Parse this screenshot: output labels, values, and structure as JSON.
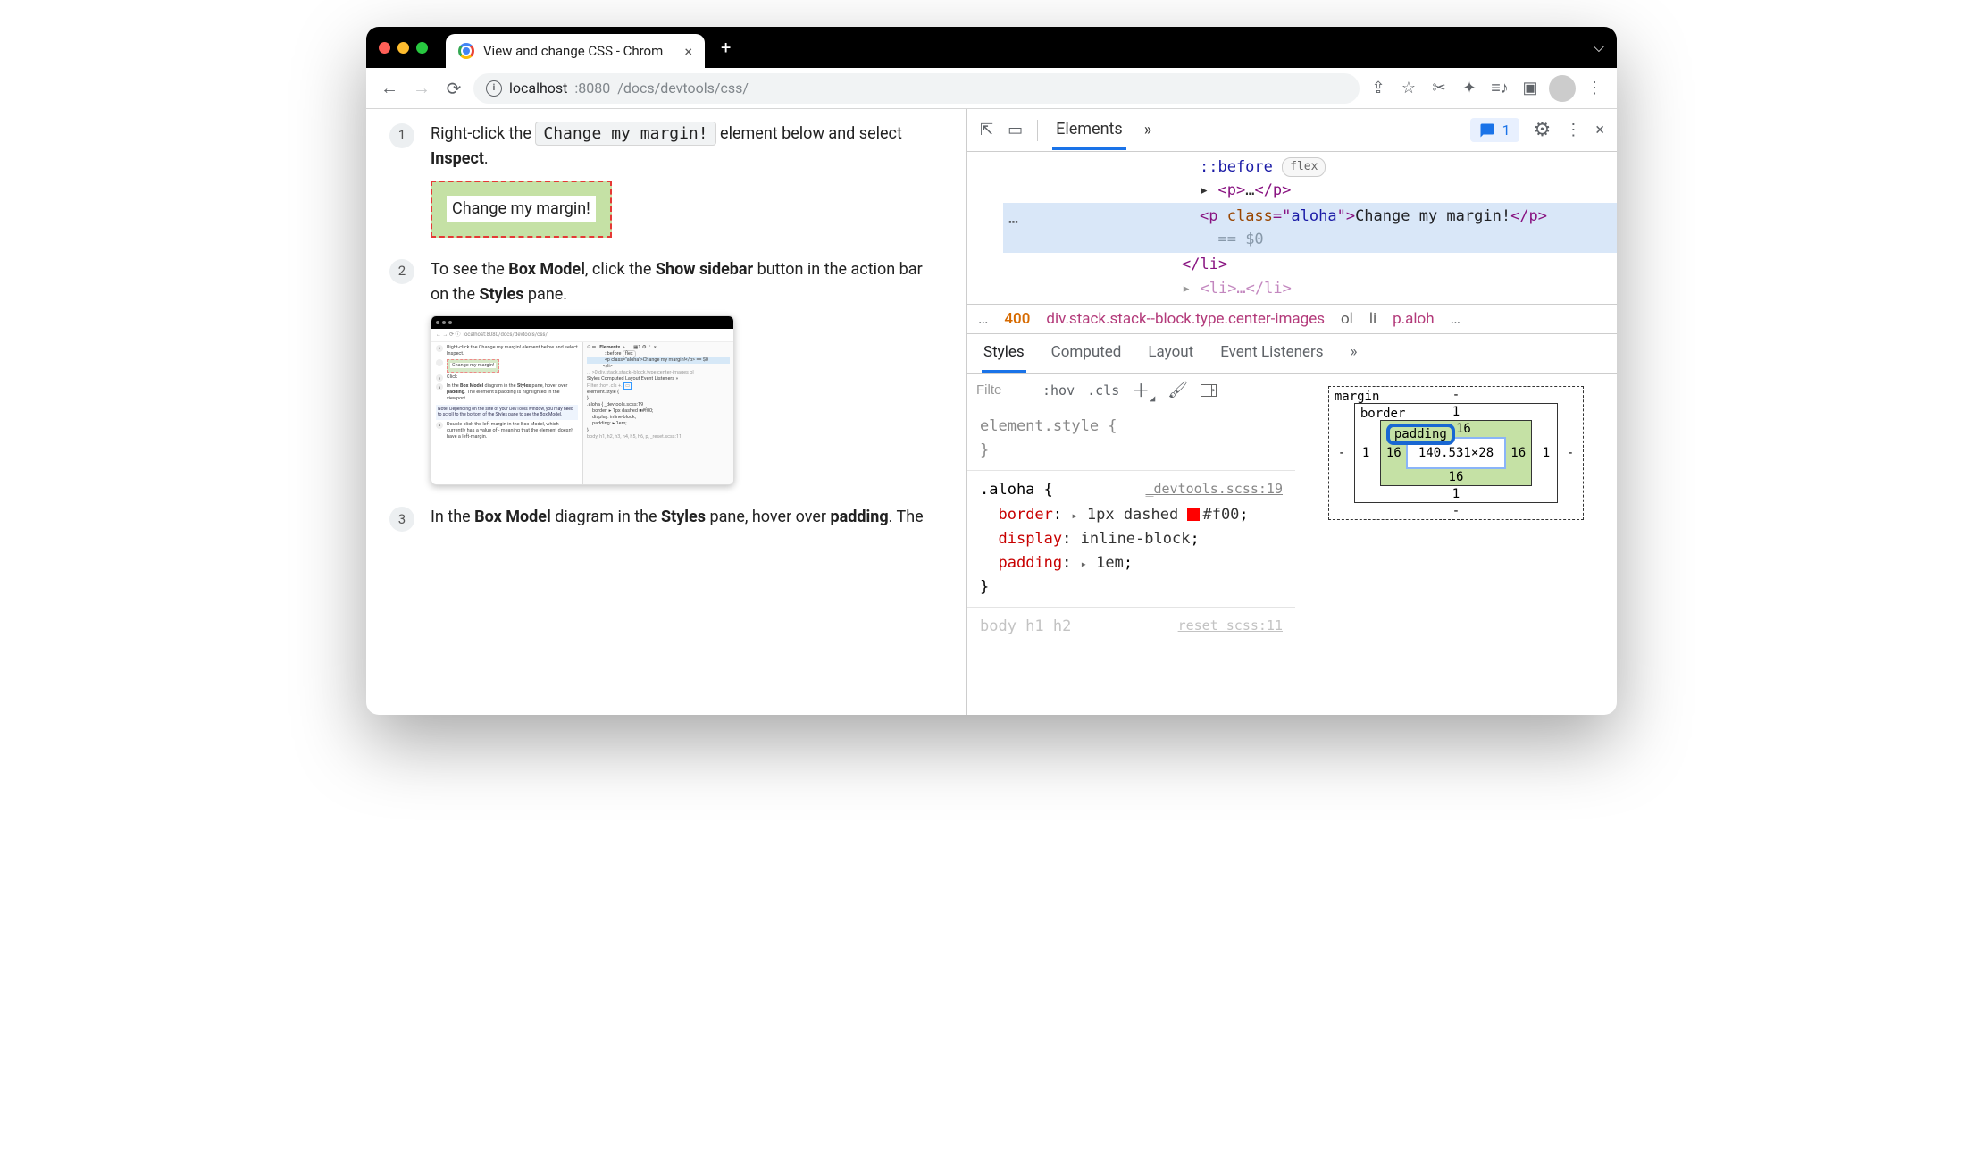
{
  "browser": {
    "tab_title": "View and change CSS - Chrom",
    "url_host": "localhost",
    "url_port": ":8080",
    "url_path": "/docs/devtools/css/"
  },
  "page": {
    "step1_a": "Right-click the ",
    "step1_code": "Change my margin!",
    "step1_b": " element below and select ",
    "step1_bold": "Inspect",
    "step1_c": ".",
    "demo_text": "Change my margin!",
    "step2_a": "To see the ",
    "step2_b1": "Box Model",
    "step2_c": ", click the ",
    "step2_b2": "Show sidebar",
    "step2_d": " button in the action bar on the ",
    "step2_b3": "Styles",
    "step2_e": " pane.",
    "step3_a": "In the ",
    "step3_b1": "Box Model",
    "step3_c": " diagram in the ",
    "step3_b2": "Styles",
    "step3_d": " pane, hover over ",
    "step3_b3": "padding",
    "step3_e": ". The"
  },
  "thumb": {
    "addr": "localhost:8080/docs/devtools/css/",
    "s1": "Right-click the Change my margin! element below and select Inspect.",
    "demo": "Change my margin!",
    "s2": "Click",
    "s3a": "In the ",
    "s3b": "Box Model",
    "s3c": " diagram in the ",
    "s3d": "Styles",
    "s3e": " pane, hover over ",
    "s3f": "padding",
    "s3g": ". The element's padding is highlighted in the viewport.",
    "note": "Note: Depending on the size of your DevTools window, you may need to scroll to the bottom of the Styles pane to see the Box Model.",
    "s4": "Double-click the left margin in the Box Model, which currently has a value of - meaning that the element doesn't have a left-margin.",
    "r_before": "::before",
    "r_flex": "flex",
    "r_sel": "<p class=\"aloha\">Change my margin!</p> == $0",
    "r_li": "</li>",
    "r_crumb": "... >0   div.stack.stack--block.type.center-images   ol",
    "r_tabs": "Styles  Computed  Layout  Event Listeners  »",
    "r_filter": "Filter          :hov .cls +.",
    "r_es": "element.style {",
    "r_aloha": ".aloha {          _devtools.scss:19",
    "r_b": "border: ▸ 1px dashed ■#f00;",
    "r_d": "display: inline-block;",
    "r_p": "padding: ▸ 1em;",
    "r_body": "body, h1, h2, h3, h4, h5, h6, p, _reset.scss:11"
  },
  "devtools": {
    "tab_elements": "Elements",
    "issues_count": "1",
    "dom_before": "::before",
    "dom_flex": "flex",
    "dom_p_collapsed": "<p>…</p>",
    "dom_sel_open": "<p ",
    "dom_sel_class": "class",
    "dom_sel_eq": "=\"",
    "dom_sel_val": "aloha",
    "dom_sel_close": "\">",
    "dom_sel_text": "Change my margin!",
    "dom_sel_end": "</p>",
    "dom_eq0": " == $0",
    "dom_li_close": "</li>",
    "crumb_dots": "…",
    "crumb_400": "400",
    "crumb_path": "div.stack.stack--block.type.center-images",
    "crumb_ol": "ol",
    "crumb_li": "li",
    "crumb_p": "p.aloh",
    "crumb_end": "…",
    "subtab_styles": "Styles",
    "subtab_computed": "Computed",
    "subtab_layout": "Layout",
    "subtab_listeners": "Event Listeners",
    "filter_placeholder": "Filte",
    "filter_hov": ":hov",
    "filter_cls": ".cls",
    "style_element": "element.style {",
    "style_close": "}",
    "aloha_sel": ".aloha {",
    "aloha_src": "_devtools.scss:19",
    "aloha_border_p": "border",
    "aloha_border_v": "1px dashed ",
    "aloha_border_hex": "#f00",
    "aloha_display_p": "display",
    "aloha_display_v": "inline-block",
    "aloha_padding_p": "padding",
    "aloha_padding_v": "1em",
    "body_sel": "body  h1  h2",
    "body_src": "reset scss:11"
  },
  "boxmodel": {
    "margin_label": "margin",
    "border_label": "border",
    "padding_label": "padding",
    "margin_top": "-",
    "margin_right": "-",
    "margin_bottom": "-",
    "margin_left": "-",
    "border_top": "1",
    "border_right": "1",
    "border_bottom": "1",
    "border_left": "1",
    "padding_top": "16",
    "padding_right": "16",
    "padding_bottom": "16",
    "padding_left": "16",
    "content": "140.531×28"
  }
}
